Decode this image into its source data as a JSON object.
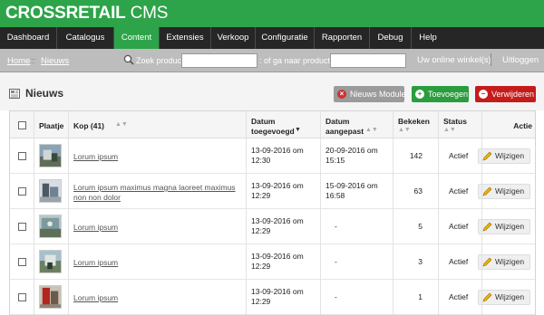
{
  "brand": {
    "name": "CROSSRETAIL",
    "suffix": " CMS"
  },
  "nav": {
    "items": [
      {
        "label": "Dashboard",
        "active": false
      },
      {
        "label": "Catalogus",
        "active": false
      },
      {
        "label": "Content",
        "active": true
      },
      {
        "label": "Extensies",
        "active": false
      },
      {
        "label": "Verkoop",
        "active": false
      },
      {
        "label": "Configuratie",
        "active": false
      },
      {
        "label": "Rapporten",
        "active": false
      },
      {
        "label": "Debug",
        "active": false
      },
      {
        "label": "Help",
        "active": false
      }
    ]
  },
  "breadcrumb": {
    "home": "Home",
    "separator": "::",
    "current": "Nieuws"
  },
  "search": {
    "label": "Zoek product",
    "value": "",
    "alt_label": ": of ga naar product id",
    "product_id_value": ""
  },
  "top_links": {
    "shop": "Uw online winkel(s)",
    "logout": "Uitloggen"
  },
  "page": {
    "title": "Nieuws"
  },
  "actions": {
    "news_module": "Nieuws Module",
    "add": "Toevoegen",
    "delete": "Verwijderen"
  },
  "table": {
    "headers": {
      "image": "Plaatje",
      "title": "Kop (41)",
      "added_1": "Datum",
      "added_2": "toegevoegd",
      "modified_1": "Datum",
      "modified_2": "aangepast",
      "views": "Bekeken",
      "status": "Status",
      "action": "Actie"
    },
    "rows": [
      {
        "title": "Lorum ipsum",
        "added_1": "13-09-2016 om",
        "added_2": "12:30",
        "modified_1": "20-09-2016 om",
        "modified_2": "15:15",
        "views": "142",
        "status": "Actief",
        "edit": "Wijzigen"
      },
      {
        "title": "Lorum ipsum maximus magna laoreet maximus non non dolor",
        "added_1": "13-09-2016 om",
        "added_2": "12:29",
        "modified_1": "15-09-2016 om",
        "modified_2": "16:58",
        "views": "63",
        "status": "Actief",
        "edit": "Wijzigen"
      },
      {
        "title": "Lorum ipsum",
        "added_1": "13-09-2016 om",
        "added_2": "12:29",
        "modified_1": "-",
        "modified_2": "",
        "views": "5",
        "status": "Actief",
        "edit": "Wijzigen"
      },
      {
        "title": "Lorum ipsum",
        "added_1": "13-09-2016 om",
        "added_2": "12:29",
        "modified_1": "-",
        "modified_2": "",
        "views": "3",
        "status": "Actief",
        "edit": "Wijzigen"
      },
      {
        "title": "Lorum ipsum",
        "added_1": "13-09-2016 om",
        "added_2": "12:29",
        "modified_1": "-",
        "modified_2": "",
        "views": "1",
        "status": "Actief",
        "edit": "Wijzigen"
      }
    ]
  },
  "colors": {
    "brand_green": "#2da449",
    "nav_dark": "#262626",
    "delete_red": "#c61b1b",
    "add_green": "#2a9d3e"
  },
  "icons": {
    "search": "magnifier-icon",
    "page": "newspaper-icon",
    "edit": "pencil-icon"
  }
}
